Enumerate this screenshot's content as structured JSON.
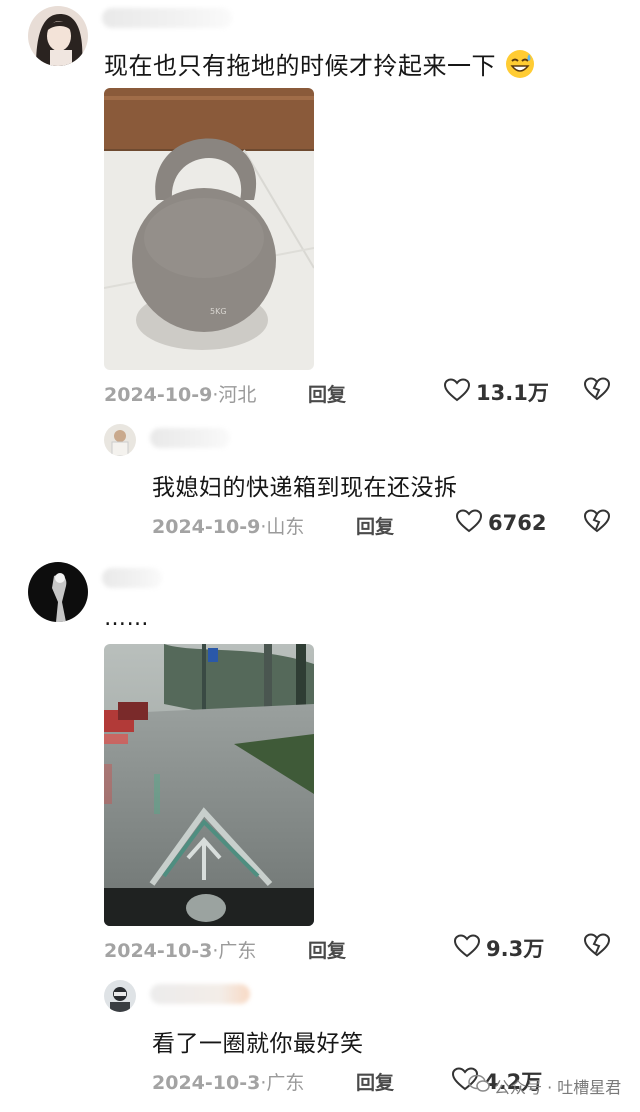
{
  "comments": [
    {
      "text": "现在也只有拖地的时候才拎起来一下",
      "emoji_icon": "grinning-sweat-icon",
      "date": "2024-10-9",
      "location": "·河北",
      "reply_label": "回复",
      "likes": "13.1万",
      "image_label": "5KG",
      "replies": [
        {
          "text": "我媳妇的快递箱到现在还没拆",
          "date": "2024-10-9",
          "location": "·山东",
          "reply_label": "回复",
          "likes": "6762"
        }
      ]
    },
    {
      "text": "……",
      "date": "2024-10-3",
      "location": "·广东",
      "reply_label": "回复",
      "likes": "9.3万",
      "replies": [
        {
          "text": "看了一圈就你最好笑",
          "date": "2024-10-3",
          "location": "·广东",
          "reply_label": "回复",
          "likes": "4.2万"
        }
      ]
    }
  ],
  "watermark": {
    "text": "公众号 · 吐槽星君",
    "icon": "wechat-icon"
  },
  "colors": {
    "heart_outline": "#333333",
    "meta_gray": "#9a9a9a"
  }
}
